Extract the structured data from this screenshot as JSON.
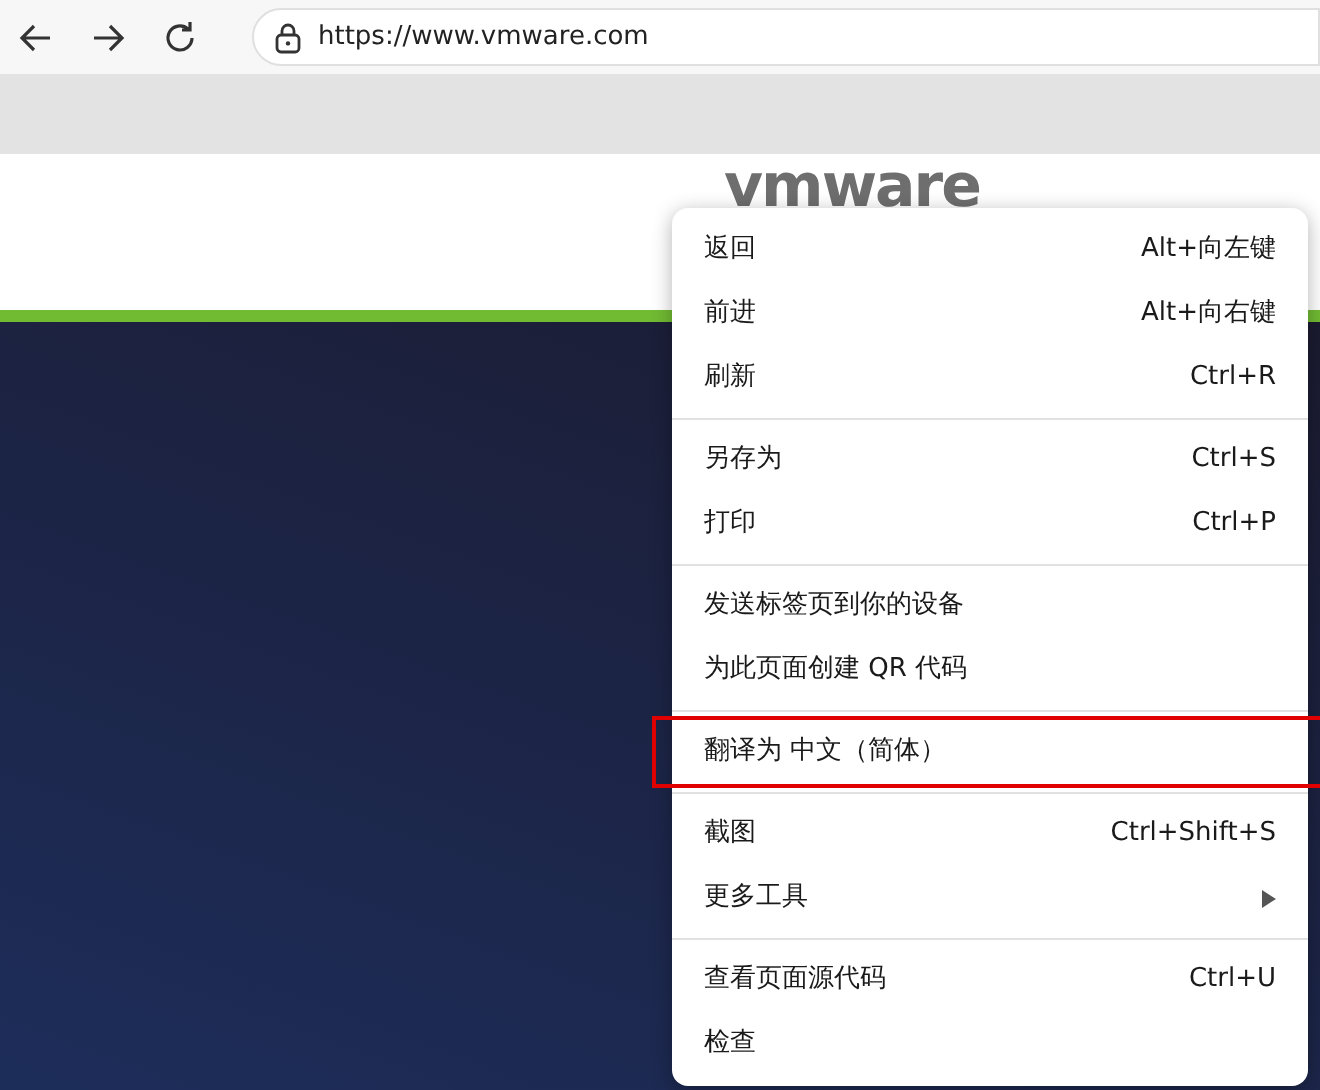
{
  "toolbar": {
    "url": "https://www.vmware.com"
  },
  "page": {
    "logo": "vmware"
  },
  "context_menu": {
    "groups": [
      [
        {
          "label": "返回",
          "shortcut": "Alt+向左键",
          "submenu": false,
          "highlighted": false
        },
        {
          "label": "前进",
          "shortcut": "Alt+向右键",
          "submenu": false,
          "highlighted": false
        },
        {
          "label": "刷新",
          "shortcut": "Ctrl+R",
          "submenu": false,
          "highlighted": false
        }
      ],
      [
        {
          "label": "另存为",
          "shortcut": "Ctrl+S",
          "submenu": false,
          "highlighted": false
        },
        {
          "label": "打印",
          "shortcut": "Ctrl+P",
          "submenu": false,
          "highlighted": false
        }
      ],
      [
        {
          "label": "发送标签页到你的设备",
          "submenu": false,
          "highlighted": false
        },
        {
          "label": "为此页面创建 QR 代码",
          "submenu": false,
          "highlighted": false
        }
      ],
      [
        {
          "label": "翻译为 中文（简体）",
          "submenu": false,
          "highlighted": true
        }
      ],
      [
        {
          "label": "截图",
          "shortcut": "Ctrl+Shift+S",
          "submenu": false,
          "highlighted": false
        },
        {
          "label": "更多工具",
          "submenu": true,
          "highlighted": false
        }
      ],
      [
        {
          "label": "查看页面源代码",
          "shortcut": "Ctrl+U",
          "submenu": false,
          "highlighted": false
        },
        {
          "label": "检查",
          "submenu": false,
          "highlighted": false
        }
      ]
    ]
  }
}
